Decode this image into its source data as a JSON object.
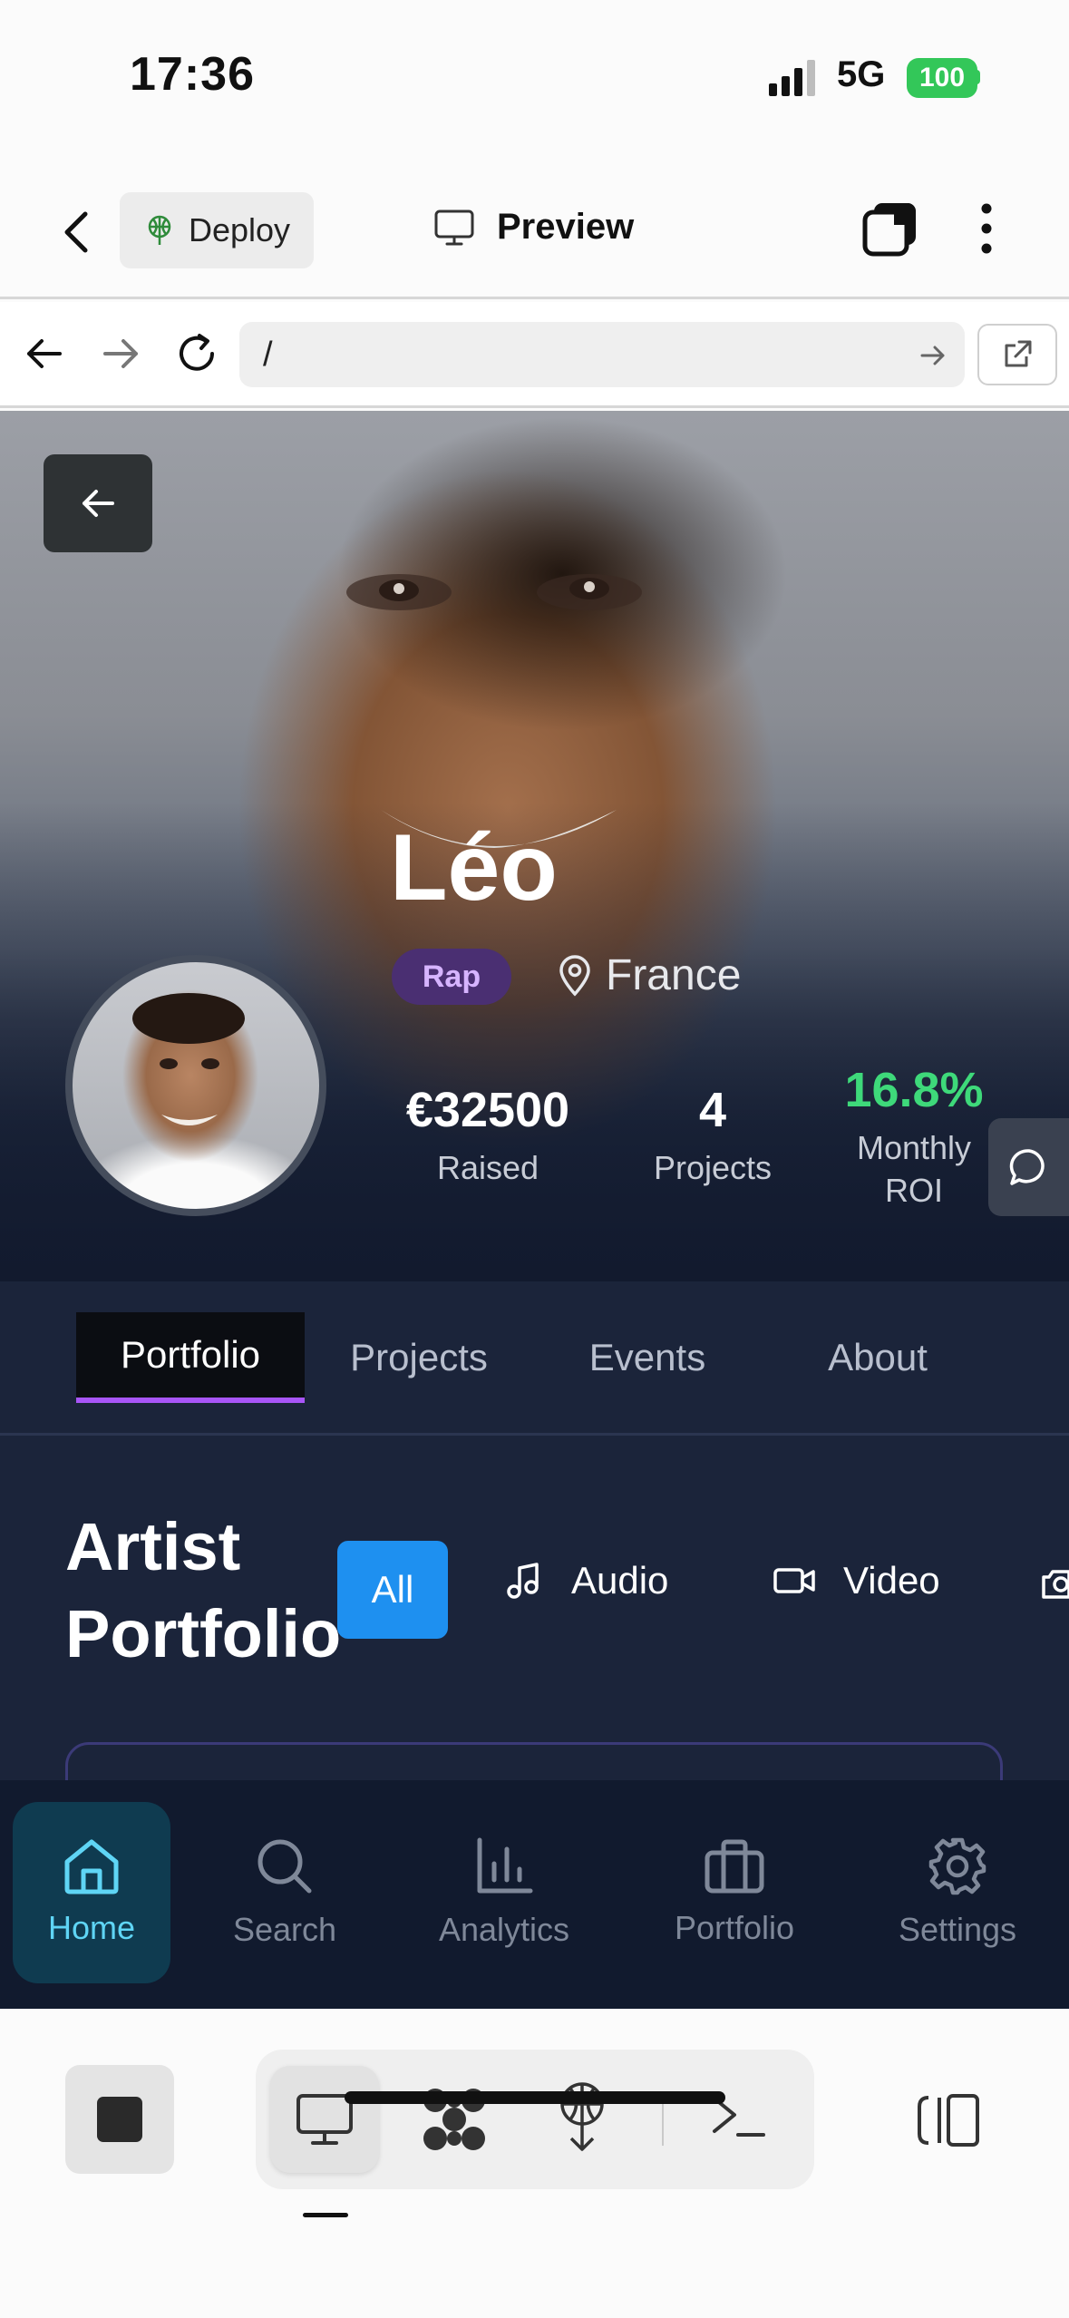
{
  "status_bar": {
    "time": "17:36",
    "network": "5G",
    "battery": "100"
  },
  "header": {
    "deploy_label": "Deploy",
    "preview_label": "Preview"
  },
  "browser": {
    "url": "/"
  },
  "artist": {
    "name": "Léo",
    "genre": "Rap",
    "location": "France",
    "stats": [
      {
        "value": "€32500",
        "label": "Raised"
      },
      {
        "value": "4",
        "label": "Projects"
      },
      {
        "value": "16.8%",
        "label_line1": "Monthly",
        "label_line2": "ROI"
      }
    ]
  },
  "tabs": [
    {
      "label": "Portfolio",
      "active": true
    },
    {
      "label": "Projects"
    },
    {
      "label": "Events"
    },
    {
      "label": "About"
    }
  ],
  "portfolio": {
    "title_line1": "Artist",
    "title_line2": "Portfolio",
    "filters": [
      {
        "label": "All",
        "icon": "all",
        "active": true
      },
      {
        "label": "Audio",
        "icon": "music-note-icon"
      },
      {
        "label": "Video",
        "icon": "video-camera-icon"
      },
      {
        "label": "",
        "icon": "camera-icon"
      }
    ]
  },
  "bottom_nav": [
    {
      "label": "Home",
      "icon": "home-icon",
      "active": true
    },
    {
      "label": "Search",
      "icon": "search-icon"
    },
    {
      "label": "Analytics",
      "icon": "bar-chart-icon"
    },
    {
      "label": "Portfolio",
      "icon": "briefcase-icon"
    },
    {
      "label": "Settings",
      "icon": "gear-icon"
    }
  ],
  "colors": {
    "accent_purple": "#a855f7",
    "roi_green": "#3ed97a",
    "filter_blue": "#1e90f0",
    "nav_active": "#5fd5f5",
    "battery_green": "#33c759"
  }
}
